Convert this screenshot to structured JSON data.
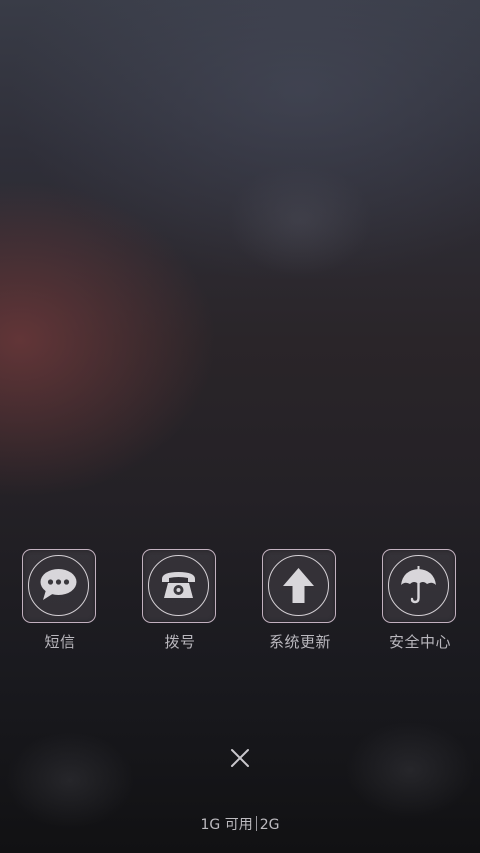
{
  "shortcuts": [
    {
      "label": "短信",
      "icon": "message-bubble-icon"
    },
    {
      "label": "拨号",
      "icon": "telephone-icon"
    },
    {
      "label": "系统更新",
      "icon": "up-arrow-icon"
    },
    {
      "label": "安全中心",
      "icon": "umbrella-icon"
    }
  ],
  "close": {
    "icon": "close-icon"
  },
  "memory": {
    "free": "1G 可用",
    "total": "2G"
  },
  "colors": {
    "tile_border": "#dcc8d7",
    "icon_fill": "#d8d6da",
    "label_text": "#b9b7bd"
  }
}
